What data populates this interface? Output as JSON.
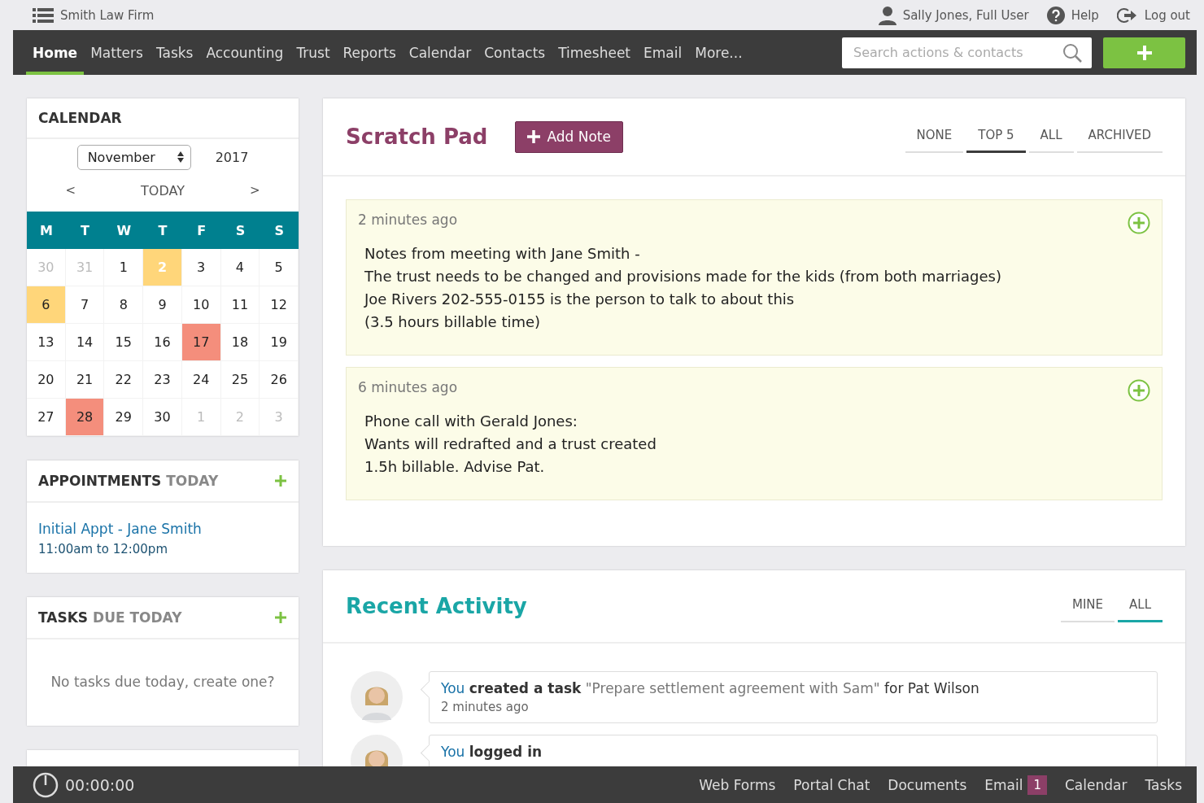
{
  "topbar": {
    "firm": "Smith Law Firm",
    "user": "Sally Jones, Full User",
    "help": "Help",
    "logout": "Log out"
  },
  "nav": {
    "items": [
      {
        "label": "Home",
        "selected": true
      },
      {
        "label": "Matters",
        "selected": false
      },
      {
        "label": "Tasks",
        "selected": false
      },
      {
        "label": "Accounting",
        "selected": false
      },
      {
        "label": "Trust",
        "selected": false
      },
      {
        "label": "Reports",
        "selected": false
      },
      {
        "label": "Calendar",
        "selected": false
      },
      {
        "label": "Contacts",
        "selected": false
      },
      {
        "label": "Timesheet",
        "selected": false
      },
      {
        "label": "Email",
        "selected": false
      },
      {
        "label": "More...",
        "selected": false
      }
    ],
    "search": {
      "placeholder": "Search actions & contacts"
    }
  },
  "calendar": {
    "title": "CALENDAR",
    "month": "November",
    "year": "2017",
    "prev": "<",
    "today": "TODAY",
    "next": ">",
    "weekdays": [
      "M",
      "T",
      "W",
      "T",
      "F",
      "S",
      "S"
    ],
    "weeks": [
      [
        {
          "day": "30",
          "muted": true,
          "today": false
        },
        {
          "day": "31",
          "muted": true,
          "today": false
        },
        {
          "day": "1",
          "muted": false,
          "today": false
        },
        {
          "day": "2",
          "muted": false,
          "today": true,
          "color": "#ffd67a"
        },
        {
          "day": "3",
          "muted": false,
          "today": false
        },
        {
          "day": "4",
          "muted": false,
          "today": false
        },
        {
          "day": "5",
          "muted": false,
          "today": false
        }
      ],
      [
        {
          "day": "6",
          "muted": false,
          "today": false,
          "color": "#ffd67a"
        },
        {
          "day": "7",
          "muted": false,
          "today": false
        },
        {
          "day": "8",
          "muted": false,
          "today": false
        },
        {
          "day": "9",
          "muted": false,
          "today": false
        },
        {
          "day": "10",
          "muted": false,
          "today": false
        },
        {
          "day": "11",
          "muted": false,
          "today": false
        },
        {
          "day": "12",
          "muted": false,
          "today": false
        }
      ],
      [
        {
          "day": "13",
          "muted": false,
          "today": false
        },
        {
          "day": "14",
          "muted": false,
          "today": false
        },
        {
          "day": "15",
          "muted": false,
          "today": false
        },
        {
          "day": "16",
          "muted": false,
          "today": false
        },
        {
          "day": "17",
          "muted": false,
          "today": false,
          "color": "#f48e7c"
        },
        {
          "day": "18",
          "muted": false,
          "today": false
        },
        {
          "day": "19",
          "muted": false,
          "today": false
        }
      ],
      [
        {
          "day": "20",
          "muted": false,
          "today": false
        },
        {
          "day": "21",
          "muted": false,
          "today": false
        },
        {
          "day": "22",
          "muted": false,
          "today": false
        },
        {
          "day": "23",
          "muted": false,
          "today": false
        },
        {
          "day": "24",
          "muted": false,
          "today": false
        },
        {
          "day": "25",
          "muted": false,
          "today": false
        },
        {
          "day": "26",
          "muted": false,
          "today": false
        }
      ],
      [
        {
          "day": "27",
          "muted": false,
          "today": false
        },
        {
          "day": "28",
          "muted": false,
          "today": false,
          "color": "#f48e7c"
        },
        {
          "day": "29",
          "muted": false,
          "today": false
        },
        {
          "day": "30",
          "muted": false,
          "today": false
        },
        {
          "day": "1",
          "muted": true,
          "today": false
        },
        {
          "day": "2",
          "muted": true,
          "today": false
        },
        {
          "day": "3",
          "muted": true,
          "today": false
        }
      ]
    ]
  },
  "appointments": {
    "title": "APPOINTMENTS",
    "title_muted": "TODAY",
    "items": [
      {
        "title": "Initial Appt - Jane Smith",
        "time": "11:00am to 12:00pm"
      }
    ]
  },
  "tasks": {
    "title": "TASKS",
    "title_muted": "DUE TODAY",
    "empty": "No tasks due today, create one?"
  },
  "scratch_pad": {
    "title": "Scratch Pad",
    "add_button": "Add Note",
    "filters": [
      {
        "label": "NONE",
        "selected": false
      },
      {
        "label": "TOP 5",
        "selected": true
      },
      {
        "label": "ALL",
        "selected": false
      },
      {
        "label": "ARCHIVED",
        "selected": false
      }
    ],
    "notes": [
      {
        "time": "2 minutes ago",
        "lines": [
          "Notes from meeting with Jane Smith -",
          "The trust needs to be changed and provisions made for the kids (from both marriages)",
          "Joe Rivers 202-555-0155 is the person to talk to about this",
          "(3.5 hours billable time)"
        ]
      },
      {
        "time": "6 minutes ago",
        "lines": [
          "Phone call with Gerald Jones:",
          "Wants will redrafted and a trust created",
          "1.5h billable. Advise Pat."
        ]
      }
    ]
  },
  "recent_activity": {
    "title": "Recent Activity",
    "filters": [
      {
        "label": "MINE",
        "selected": false
      },
      {
        "label": "ALL",
        "selected": true
      }
    ],
    "items": [
      {
        "actor": "You",
        "action": "created a task",
        "quote": "\"Prepare settlement agreement with Sam\"",
        "rest": "for Pat Wilson",
        "time": "2 minutes ago"
      },
      {
        "actor": "You",
        "action": "logged in"
      }
    ]
  },
  "footer": {
    "timer": "00:00:00",
    "links": [
      {
        "label": "Web Forms"
      },
      {
        "label": "Portal Chat"
      },
      {
        "label": "Documents"
      },
      {
        "label": "Email",
        "badge": "1"
      },
      {
        "label": "Calendar"
      },
      {
        "label": "Tasks"
      }
    ]
  }
}
